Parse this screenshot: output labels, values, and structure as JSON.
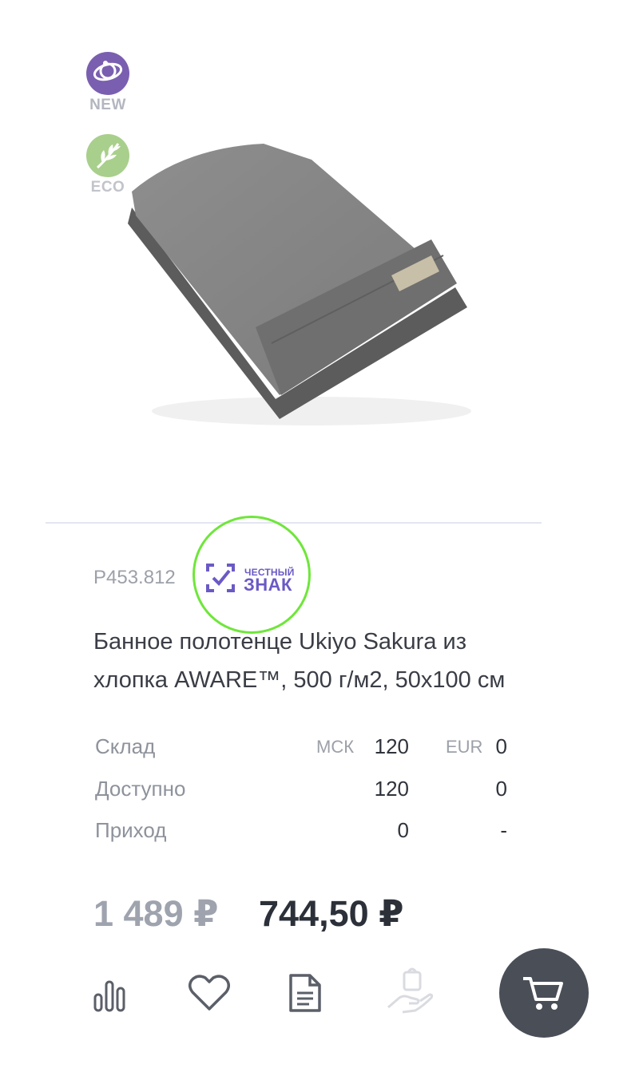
{
  "badges": {
    "new_label": "NEW",
    "eco_label": "ECO"
  },
  "product": {
    "sku": "P453.812",
    "title_line1": "Банное полотенце Ukiyo Sakura из",
    "title_line2": "хлопка AWARE™, 500 г/м2, 50х100 см",
    "marking": {
      "line1": "ЧЕСТНЫЙ",
      "line2": "ЗНАК"
    }
  },
  "stock": {
    "columns": [
      "МСК",
      "EUR"
    ],
    "rows": [
      {
        "label": "Склад",
        "msk": "120",
        "eur": "0"
      },
      {
        "label": "Доступно",
        "msk": "120",
        "eur": "0"
      },
      {
        "label": "Приход",
        "msk": "0",
        "eur": "-"
      }
    ]
  },
  "prices": {
    "old": "1 489 ₽",
    "new": "744,50 ₽"
  },
  "icons": [
    "stats-icon",
    "heart-icon",
    "document-icon",
    "hand-bag-icon",
    "cart-icon"
  ],
  "colors": {
    "accent": "#6a5ac5",
    "highlight": "#6fe63a",
    "cart_bg": "#4a4e57"
  }
}
